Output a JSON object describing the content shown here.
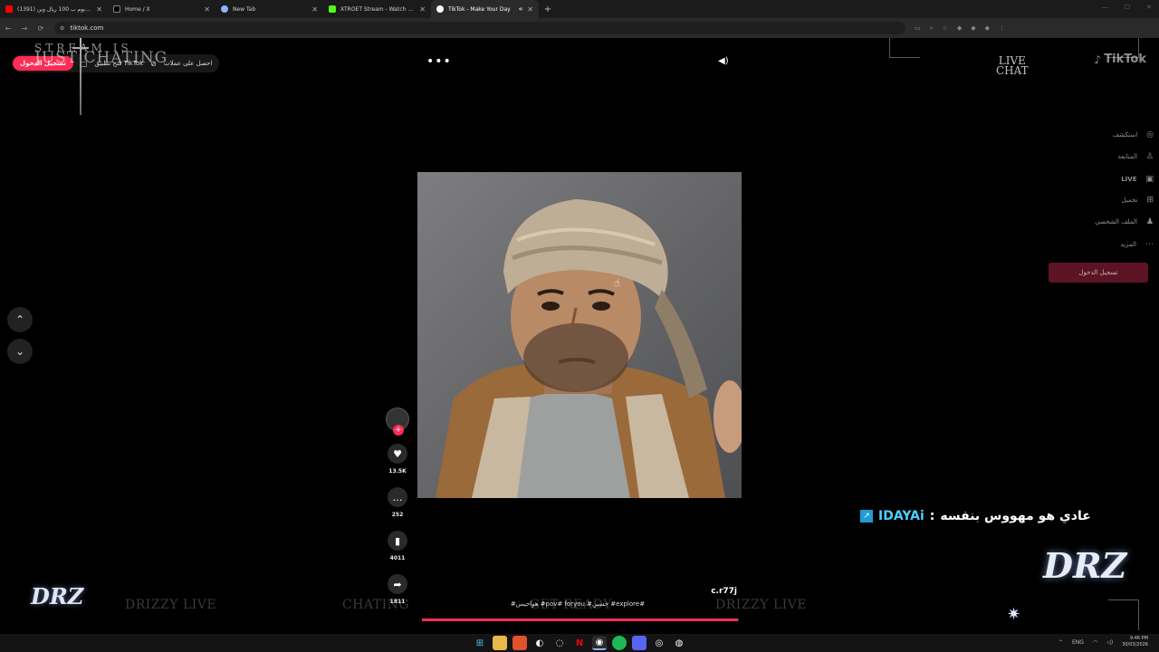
{
  "browser": {
    "tabs": [
      {
        "title": "(1391) مشت يوم ب 100 ريال وين",
        "active": false,
        "fav_color": "#ff0000"
      },
      {
        "title": "Home / X",
        "active": false,
        "fav_color": "#222222"
      },
      {
        "title": "New Tab",
        "active": false,
        "fav_color": "#8ab4f8"
      },
      {
        "title": "XTROET Stream - Watch Live o",
        "active": false,
        "fav_color": "#53fc18"
      },
      {
        "title": "TikTok - Make Your Day",
        "active": true,
        "fav_color": "#ffffff"
      }
    ],
    "new_tab_glyph": "+",
    "url": "tiktok.com"
  },
  "top_left": {
    "login_label": "تسجيل الدخول",
    "app_label": "فتح تطبيق TikTok",
    "coins_label": "احصل على عملات"
  },
  "overlay": {
    "stream_logo_line1": "STREAM IS",
    "stream_logo_line2": "JUST CHATING",
    "live_chat_line1": "LIVE",
    "live_chat_line2": "CHAT",
    "watermarks": [
      "DRIZZY LIVE",
      "CHATING",
      "GET READY",
      "DRIZZY LIVE"
    ],
    "drz_logo": "DRZ"
  },
  "video": {
    "username": "c.r77j",
    "tags": "#explore# حسين# pov# foryou# هواجيس#",
    "progress": 0.998
  },
  "actions": {
    "likes": "13.5K",
    "comments": "252",
    "saves": "4011",
    "shares": "1811"
  },
  "sidebar": {
    "logo": "TikTok",
    "items": [
      {
        "label": "استكشف",
        "icon": "compass-icon"
      },
      {
        "label": "المتابعة",
        "icon": "person-icon"
      },
      {
        "label": "LIVE",
        "icon": "live-icon"
      },
      {
        "label": "تحميل",
        "icon": "upload-icon"
      },
      {
        "label": "الملف الشخصي",
        "icon": "profile-icon"
      },
      {
        "label": "المزيد",
        "icon": "more-icon"
      }
    ],
    "login_button": "تسجيل الدخول"
  },
  "chat": {
    "username": "IDAYAi",
    "separator": ":",
    "message": "عادي هو مهووس بنفسه"
  },
  "taskbar": {
    "lang": "ENG",
    "time": "9:46 PM",
    "date": "30/03/2026"
  },
  "colors": {
    "accent": "#fe2c55",
    "chat_name": "#48d1ff"
  }
}
